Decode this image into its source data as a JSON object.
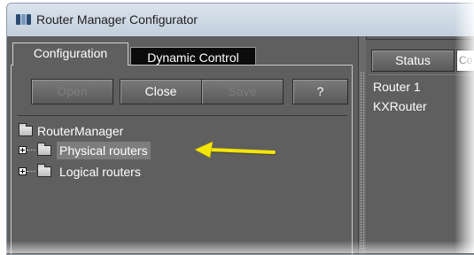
{
  "window": {
    "title": "Router Manager Configurator",
    "app_icon": "router-manager-app-icon"
  },
  "tabs": [
    {
      "label": "Configuration",
      "active": true
    },
    {
      "label": "Dynamic Control",
      "active": false
    }
  ],
  "toolbar": {
    "open_label": "Open",
    "close_label": "Close",
    "save_label": "Save",
    "help_label": "?"
  },
  "tree": {
    "root": {
      "label": "RouterManager",
      "icon": "folder-icon"
    },
    "children": [
      {
        "label": "Physical routers",
        "icon": "folder-icon",
        "expander": "plus",
        "selected": true
      },
      {
        "label": "Logical routers",
        "icon": "folder-icon",
        "expander": "plus",
        "selected": false
      }
    ]
  },
  "annotation": {
    "arrow_color": "#f5e40a",
    "points_to": "Physical routers"
  },
  "status_panel": {
    "button_label": "Status",
    "input_value": "Co",
    "routers": [
      "Router 1",
      "KXRouter"
    ]
  },
  "colors": {
    "panel_bg": "#5f5f5f",
    "titlebar_bg": "#d3dde8",
    "selection_bg": "#7d7d7d"
  }
}
